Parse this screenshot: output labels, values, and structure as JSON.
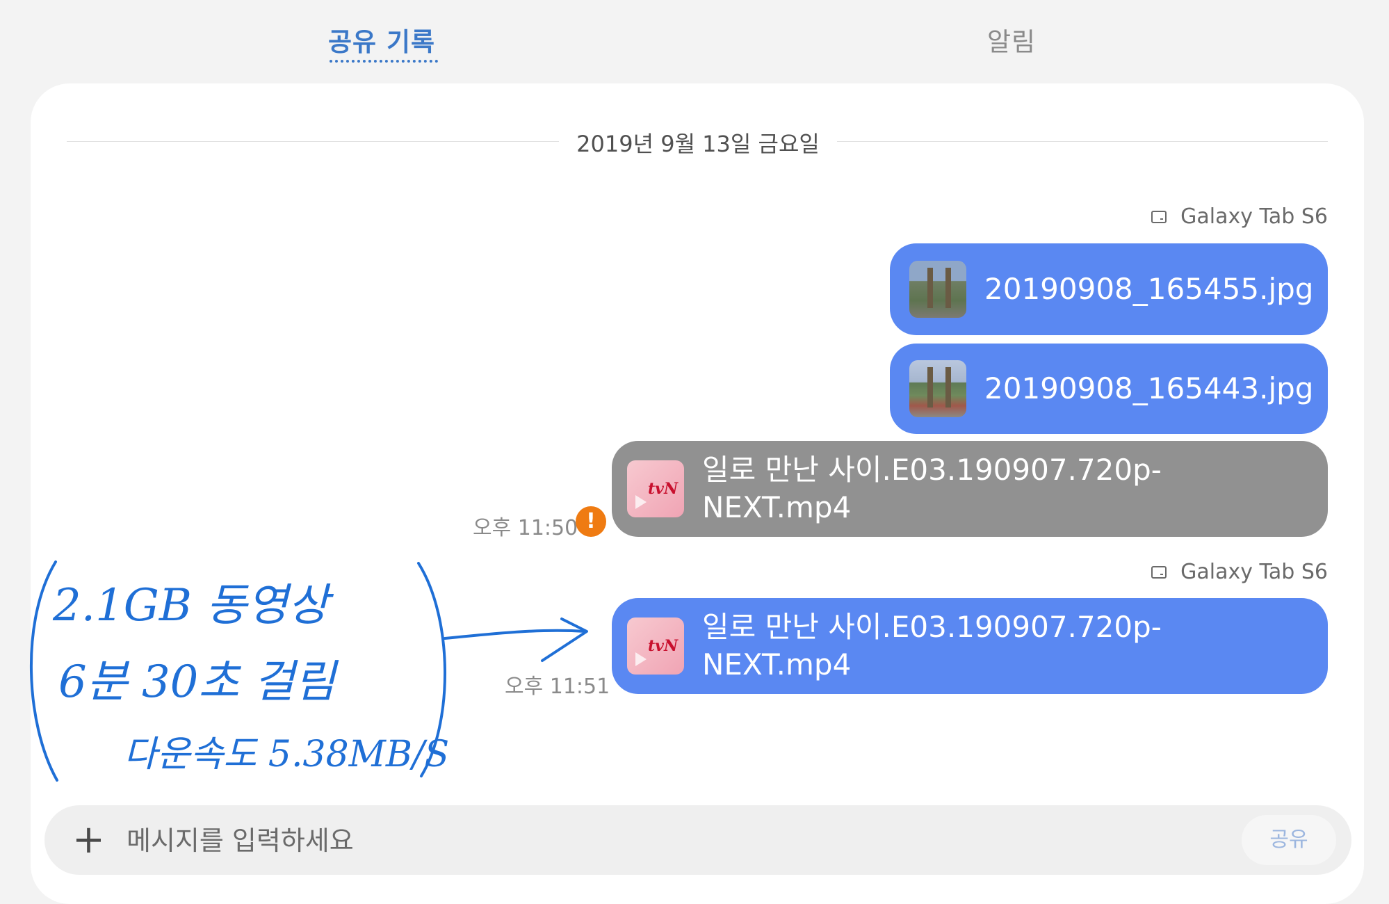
{
  "tabs": [
    {
      "label": "공유 기록",
      "active": true
    },
    {
      "label": "알림",
      "active": false
    }
  ],
  "date_header": "2019년 9월 13일 금요일",
  "messages": [
    {
      "file": "20190908_165455.jpg",
      "sender": "Galaxy Tab S6"
    },
    {
      "file": "20190908_165443.jpg"
    },
    {
      "file": "일로 만난 사이.E03.190907.720p-NEXT.mp4",
      "line1": "일로 만난 사이.E03.190907.720p-",
      "line2": "NEXT.mp4",
      "time": "오후 11:50",
      "status": "error"
    },
    {
      "file": "일로 만난 사이.E03.190907.720p-NEXT.mp4",
      "line1": "일로 만난 사이.E03.190907.720p-",
      "line2": "NEXT.mp4",
      "time": "오후 11:51",
      "sender": "Galaxy Tab S6"
    }
  ],
  "thumb_logo": "tvN",
  "annotation": {
    "line1": "2.1GB 동영상",
    "line2": "6분 30초 걸림",
    "line3": "다운속도 5.38MB/S"
  },
  "input": {
    "placeholder": "메시지를 입력하세요",
    "add_icon": "plus-icon",
    "send_label": "공유"
  },
  "colors": {
    "accent": "#3b78c8",
    "bubble_sent": "#5a88f2",
    "bubble_failed": "#919191",
    "error": "#ef7b12",
    "handwriting": "#1f6fd6"
  }
}
